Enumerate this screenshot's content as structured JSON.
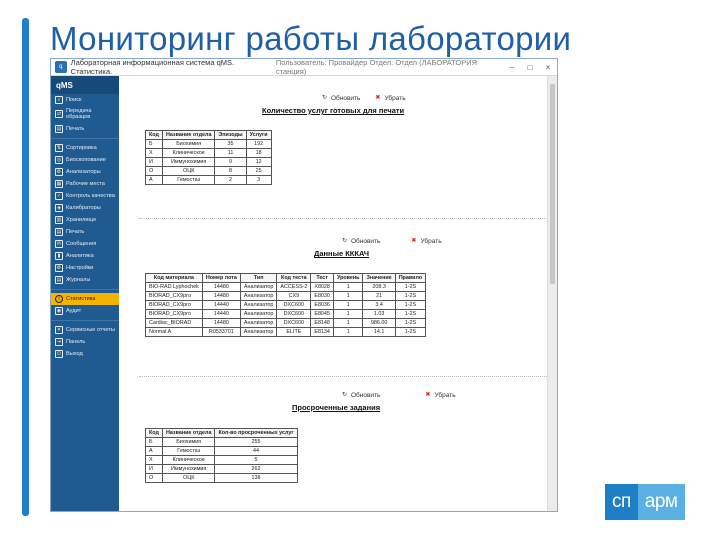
{
  "slide": {
    "title": "Мониторинг работы лаборатории"
  },
  "window": {
    "title": "Лабораторная информационная система qMS. Статистика.",
    "title_blurred": "Пользователь: Провайдер Отдел: Отдел (ЛАБОРАТОРИЯ станция)",
    "controls": [
      "–",
      "□",
      "×"
    ]
  },
  "sidebar": {
    "logo": "qMS",
    "items": [
      {
        "label": "Поиск",
        "icon": "search-icon",
        "glyph": "⌕"
      },
      {
        "label": "Передача образцов",
        "icon": "transfer-icon",
        "glyph": "⇄"
      },
      {
        "label": "Печать",
        "icon": "printer-icon",
        "glyph": "▤"
      },
      {
        "label": "Сортировка",
        "icon": "sort-icon",
        "glyph": "⇅"
      },
      {
        "label": "Биоскопование",
        "icon": "biosample-icon",
        "glyph": "◎"
      },
      {
        "label": "Анализаторы",
        "icon": "analyzer-icon",
        "glyph": "⚙"
      },
      {
        "label": "Рабочие места",
        "icon": "workplace-icon",
        "glyph": "▦"
      },
      {
        "label": "Контроль качества",
        "icon": "quality-control-icon",
        "glyph": "✓"
      },
      {
        "label": "Калибраторы",
        "icon": "calibrator-icon",
        "glyph": "◈"
      },
      {
        "label": "Хранилище",
        "icon": "storage-icon",
        "glyph": "▥"
      },
      {
        "label": "Печать",
        "icon": "print-icon",
        "glyph": "▤"
      },
      {
        "label": "Сообщения",
        "icon": "messages-icon",
        "glyph": "✉"
      },
      {
        "label": "Аналитика",
        "icon": "analytics-icon",
        "glyph": "▮"
      },
      {
        "label": "Настройки",
        "icon": "settings-icon",
        "glyph": "⚙"
      },
      {
        "label": "Журналы",
        "icon": "journal-icon",
        "glyph": "▤"
      },
      {
        "label": "Статистика",
        "icon": "statistics-icon",
        "glyph": "i",
        "active": true
      },
      {
        "label": "Аудит",
        "icon": "audit-icon",
        "glyph": "◉"
      },
      {
        "label": "Сервисные отчеты",
        "icon": "service-reports-icon",
        "glyph": "✕"
      },
      {
        "label": "Панель",
        "icon": "panel-icon",
        "glyph": "⇥"
      },
      {
        "label": "Выход",
        "icon": "exit-icon",
        "glyph": "⏻"
      }
    ]
  },
  "toolbar": {
    "refresh": "Обновить",
    "remove": "Убрать"
  },
  "section1": {
    "title": "Количество услуг готовых для печати",
    "columns": [
      "Код",
      "Название отдела",
      "Эпизоды",
      "Услуги"
    ],
    "rows": [
      [
        "Б",
        "Биохимия",
        "35",
        "192"
      ],
      [
        "Х",
        "Клиническое",
        "11",
        "18"
      ],
      [
        "И",
        "Иммунохимия",
        "9",
        "12"
      ],
      [
        "О",
        "ОЦК",
        "8",
        "25"
      ],
      [
        "А",
        "Гемостаз",
        "2",
        "3"
      ]
    ]
  },
  "section2": {
    "title": "Данные КККАЧ",
    "columns": [
      "Код материала",
      "Номер лота",
      "Тип",
      "Код теста",
      "Тест",
      "Уровень",
      "Значение",
      "Правило"
    ],
    "rows": [
      [
        "BIO-RAD Lyphochek",
        "14480",
        "Анализатор",
        "ACCESS-2",
        "X8028",
        "1",
        "208.3",
        "1-2S"
      ],
      [
        "BIORAD_CX9pro",
        "14480",
        "Анализатор",
        "CX9",
        "E8030",
        "1",
        "21",
        "1-2S"
      ],
      [
        "BIORAD_CX9pro",
        "14440",
        "Анализатор",
        "DXC600",
        "E8036",
        "1",
        "3.4",
        "1-2S"
      ],
      [
        "BIORAD_CX9pro",
        "14440",
        "Анализатор",
        "DXC600",
        "E8045",
        "1",
        "1.03",
        "1-2S"
      ],
      [
        "Cardiac_BIORAD",
        "14480",
        "Анализатор",
        "DXC600",
        "E8148",
        "1",
        "986.00",
        "1-2S"
      ],
      [
        "Normal A",
        "R0533701",
        "Анализатор",
        "ELITE",
        "E8134",
        "1",
        "14.1",
        "1-2S"
      ]
    ]
  },
  "section3": {
    "title": "Просроченные задания",
    "columns": [
      "Код",
      "Название отдела",
      "Кол-во просроченных услуг"
    ],
    "rows": [
      [
        "Б",
        "Биохимия",
        "255"
      ],
      [
        "А",
        "Гемостаз",
        "44"
      ],
      [
        "Х",
        "Клиническое",
        "5"
      ],
      [
        "И",
        "Иммунохимия",
        "262"
      ],
      [
        "О",
        "ОЦК",
        "138"
      ]
    ]
  },
  "brand": {
    "part1": "сп",
    "part2": "арм",
    "colors": {
      "primary": "#1e7fc7",
      "secondary": "#5bb0e3"
    }
  }
}
